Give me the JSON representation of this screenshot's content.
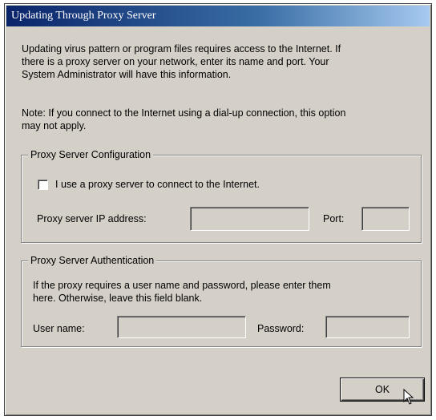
{
  "dialog": {
    "title": "Updating Through Proxy Server",
    "intro_line1": "Updating virus pattern or program files requires access to the Internet. If",
    "intro_line2": "there is a proxy server on your network, enter its name and port. Your",
    "intro_line3": "System Administrator will have this information.",
    "note_line1": "Note: If you connect to the Internet using a dial-up connection, this option",
    "note_line2": "may not apply."
  },
  "proxy_config": {
    "group_title": "Proxy Server Configuration",
    "checkbox_label": "I use a proxy server to connect to the Internet.",
    "checkbox_checked": false,
    "ip_label": "Proxy server IP address:",
    "ip_value": "",
    "port_label": "Port:",
    "port_value": ""
  },
  "proxy_auth": {
    "group_title": "Proxy Server Authentication",
    "desc_line1": "If the proxy requires a user name and password, please enter them",
    "desc_line2": "here. Otherwise, leave this field blank.",
    "username_label": "User name:",
    "username_value": "",
    "password_label": "Password:",
    "password_value": ""
  },
  "buttons": {
    "ok_label": "OK"
  },
  "icons": {
    "cursor": "mouse-pointer-icon"
  },
  "colors": {
    "face": "#d4d0c8",
    "title_start": "#0a246a",
    "title_end": "#a6caf0"
  }
}
